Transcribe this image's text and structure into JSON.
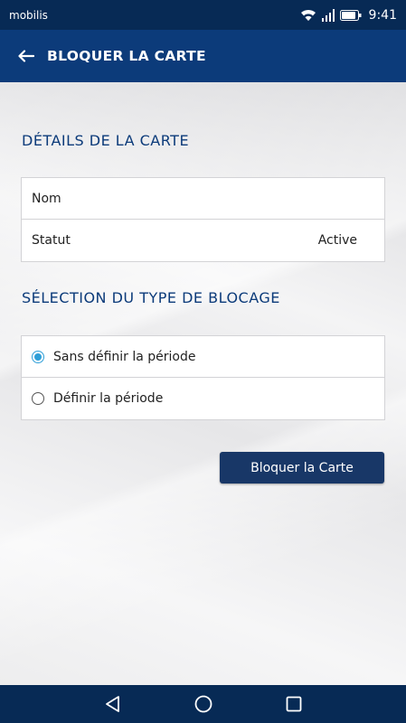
{
  "status_bar": {
    "carrier": "mobilis",
    "time": "9:41",
    "icons": [
      "wifi-icon",
      "signal-icon",
      "battery-icon"
    ]
  },
  "app_bar": {
    "back_icon": "arrow-left-icon",
    "title": "BLOQUER LA CARTE"
  },
  "card_details": {
    "section_title": "DÉTAILS DE LA CARTE",
    "rows": [
      {
        "label": "Nom",
        "value": ""
      },
      {
        "label": "Statut",
        "value": "Active"
      }
    ]
  },
  "blocking_type": {
    "section_title": "SÉLECTION DU TYPE DE BLOCAGE",
    "options": [
      {
        "label": "Sans définir la période",
        "selected": true
      },
      {
        "label": "Définir la période",
        "selected": false
      }
    ]
  },
  "actions": {
    "block_button": "Bloquer la Carte"
  },
  "nav_bar": {
    "icons": [
      "nav-back-icon",
      "nav-home-icon",
      "nav-recents-icon"
    ]
  },
  "colors": {
    "status_bar_bg": "#072a55",
    "app_bar_bg": "#0c3b7a",
    "accent": "#0c3b7a",
    "radio_selected": "#2f9fd8",
    "button_bg": "#183767"
  }
}
